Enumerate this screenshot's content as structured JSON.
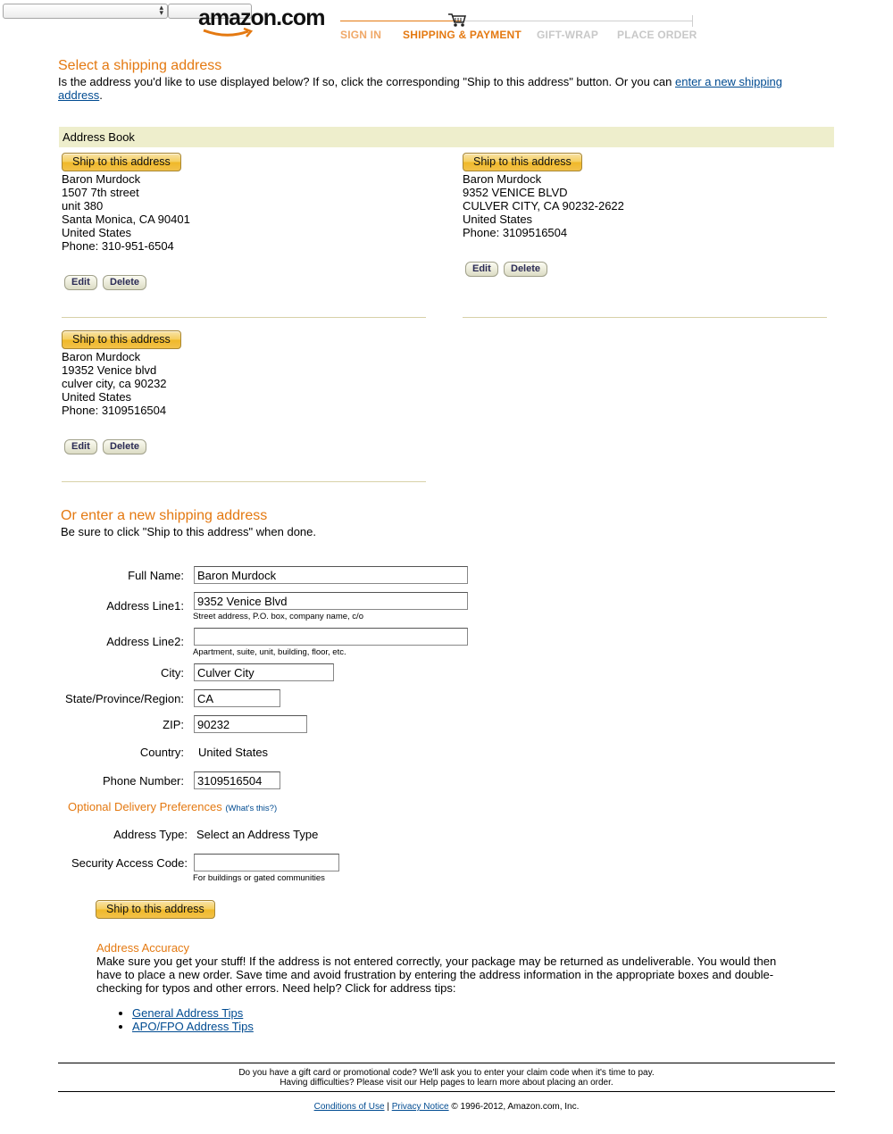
{
  "header": {
    "logo_text": "amazon.com",
    "steps": [
      {
        "label": "SIGN IN",
        "state": "done"
      },
      {
        "label": "SHIPPING & PAYMENT",
        "state": "current"
      },
      {
        "label": "GIFT-WRAP",
        "state": "todo"
      },
      {
        "label": "PLACE ORDER",
        "state": "todo"
      }
    ],
    "cart_icon": "shopping-cart-icon"
  },
  "select_section": {
    "title": "Select a shipping address",
    "intro": "Is the address you'd like to use displayed below? If so, click the corresponding \"Ship to this address\" button. Or you can",
    "intro_link": "enter a new shipping address",
    "intro_end": "."
  },
  "address_book": {
    "title": "Address Book",
    "ship_label": "Ship to this address",
    "edit_label": "Edit",
    "delete_label": "Delete",
    "addresses": [
      {
        "lines": [
          "Baron Murdock",
          "1507 7th street",
          "unit 380",
          "Santa Monica, CA 90401",
          "United States",
          "Phone: 310-951-6504"
        ]
      },
      {
        "lines": [
          "Baron Murdock",
          "9352 VENICE BLVD",
          "CULVER CITY, CA 90232-2622",
          "United States",
          "Phone: 3109516504"
        ]
      },
      {
        "lines": [
          "Baron Murdock",
          "19352 Venice blvd",
          "culver city, ca 90232",
          "United States",
          "Phone: 3109516504"
        ]
      }
    ]
  },
  "new_address": {
    "title": "Or enter a new shipping address",
    "subtitle": "Be sure to click \"Ship to this address\" when done.",
    "full_name_label": "Full Name:",
    "full_name_value": "Baron Murdock",
    "addr1_label": "Address Line1:",
    "addr1_value": "9352 Venice Blvd",
    "addr1_hint": "Street address, P.O. box, company name, c/o",
    "addr2_label": "Address Line2:",
    "addr2_value": "",
    "addr2_hint": "Apartment, suite, unit, building, floor, etc.",
    "city_label": "City:",
    "city_value": "Culver City",
    "state_label": "State/Province/Region:",
    "state_value": "CA",
    "zip_label": "ZIP:",
    "zip_value": "90232",
    "country_label": "Country:",
    "country_value": "United States",
    "phone_label": "Phone Number:",
    "phone_value": "3109516504",
    "optional_title": "Optional Delivery Preferences",
    "whats_this": "What's this?",
    "address_type_label": "Address Type:",
    "address_type_value": "Select an Address Type",
    "security_label": "Security Access Code:",
    "security_value": "",
    "security_hint": "For buildings or gated communities",
    "ship_label": "Ship to this address"
  },
  "accuracy": {
    "title": "Address Accuracy",
    "body": "Make sure you get your stuff! If the address is not entered correctly, your package may be returned as undeliverable. You would then have to place a new order. Save time and avoid frustration by entering the address information in the appropriate boxes and double-checking for typos and other errors. Need help? Click for address tips:",
    "tips": [
      "General Address Tips",
      "APO/FPO Address Tips"
    ]
  },
  "footer": {
    "line1": "Do you have a gift card or promotional code? We'll ask you to enter your claim code when it's time to pay.",
    "line2": "Having difficulties? Please visit our Help pages to learn more about placing an order.",
    "conditions": "Conditions of Use",
    "separator": "|",
    "privacy": "Privacy Notice",
    "copyright": "© 1996-2012, Amazon.com, Inc."
  }
}
